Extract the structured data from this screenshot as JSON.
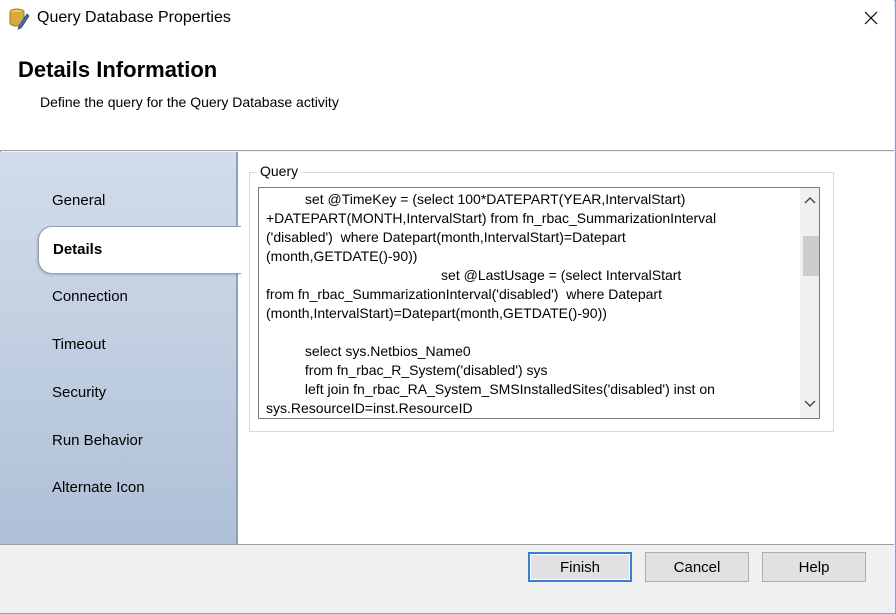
{
  "window": {
    "title": "Query Database Properties"
  },
  "header": {
    "title": "Details Information",
    "subtitle": "Define the query for the Query Database activity"
  },
  "sidebar": {
    "items": [
      {
        "label": "General"
      },
      {
        "label": "Details",
        "active": true
      },
      {
        "label": "Connection"
      },
      {
        "label": "Timeout"
      },
      {
        "label": "Security"
      },
      {
        "label": "Run Behavior"
      },
      {
        "label": "Alternate Icon"
      }
    ]
  },
  "query": {
    "group_label": "Query",
    "text": "          set @TimeKey = (select 100*DATEPART(YEAR,IntervalStart)\n+DATEPART(MONTH,IntervalStart) from fn_rbac_SummarizationInterval\n('disabled')  where Datepart(month,IntervalStart)=Datepart\n(month,GETDATE()-90))\n                                             set @LastUsage = (select IntervalStart\nfrom fn_rbac_SummarizationInterval('disabled')  where Datepart\n(month,IntervalStart)=Datepart(month,GETDATE()-90))\n\n          select sys.Netbios_Name0\n          from fn_rbac_R_System('disabled') sys\n          left join fn_rbac_RA_System_SMSInstalledSites('disabled') inst on\nsys.ResourceID=inst.ResourceID"
  },
  "buttons": {
    "finish": "Finish",
    "cancel": "Cancel",
    "help": "Help"
  },
  "icons": {
    "app": "database-pencil-icon",
    "close": "close-icon",
    "scroll_up": "chevron-up-icon",
    "scroll_down": "chevron-down-icon"
  },
  "colors": {
    "sidebar": "#c3d0e2",
    "default_button_border": "#3c7fd1"
  }
}
